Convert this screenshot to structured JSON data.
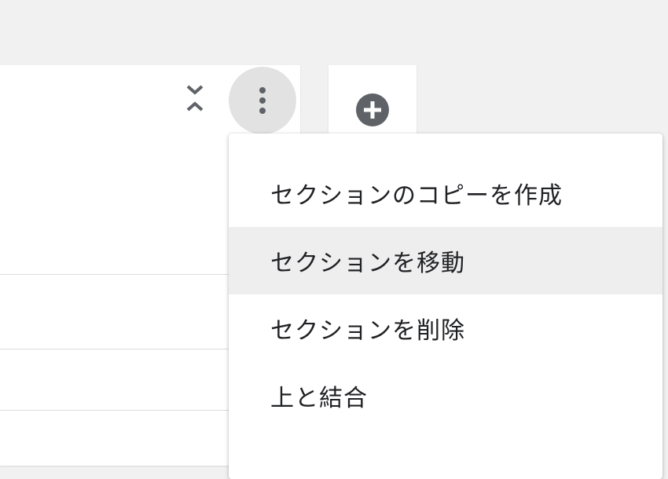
{
  "section": {
    "collapse_icon": "unfold-less-icon",
    "more_icon": "more-vert-icon"
  },
  "add_panel": {
    "add_icon": "add-circle-icon"
  },
  "menu": {
    "items": [
      {
        "label": "セクションのコピーを作成"
      },
      {
        "label": "セクションを移動",
        "highlighted": true
      },
      {
        "label": "セクションを削除"
      },
      {
        "label": "上と結合"
      }
    ]
  },
  "colors": {
    "background": "#f1f1f1",
    "card": "#ffffff",
    "icon": "#5f6368",
    "menu_highlight": "#eeeeee"
  }
}
